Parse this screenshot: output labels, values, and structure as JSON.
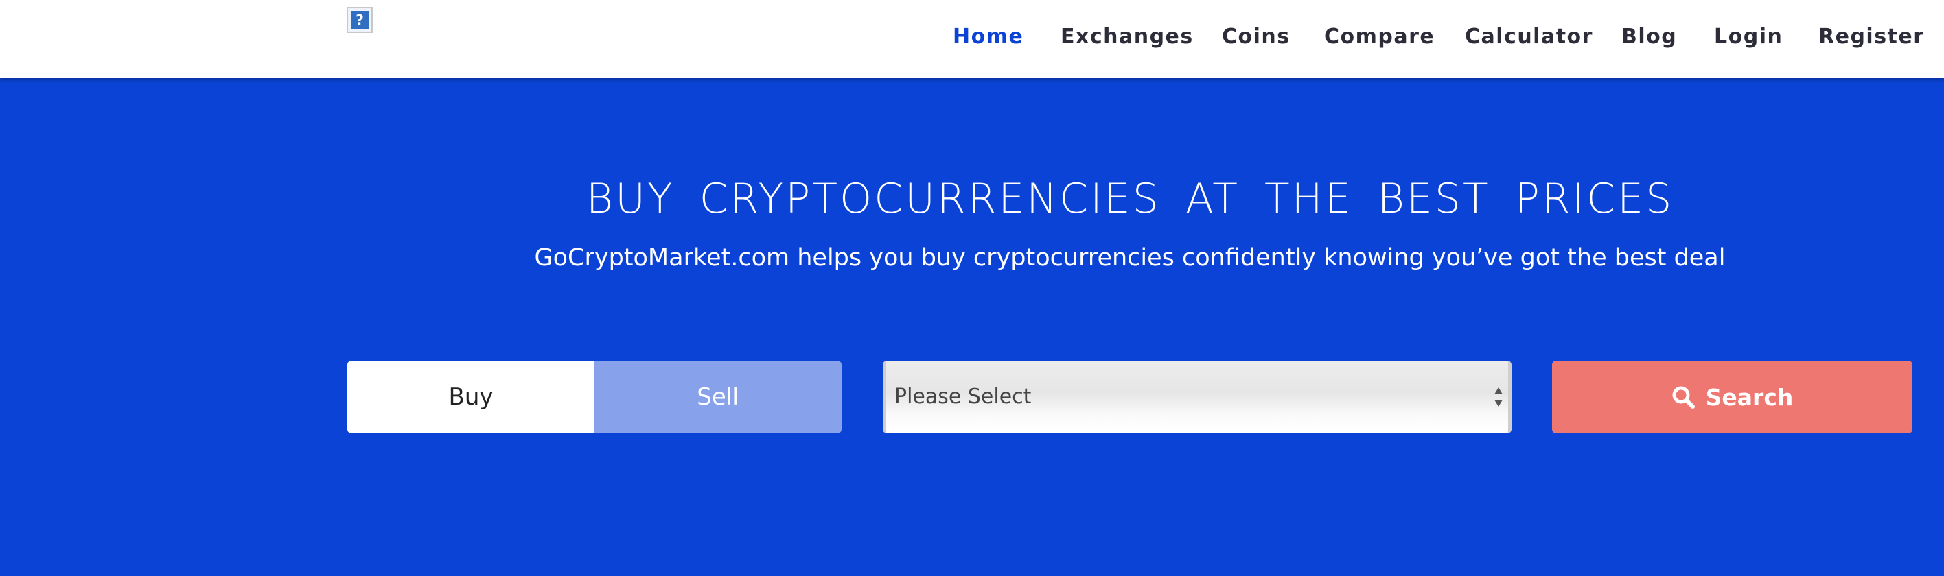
{
  "header": {
    "logo_icon": "broken-image-placeholder-icon",
    "logo_glyph": "?",
    "nav": [
      {
        "label": "Home",
        "active": true
      },
      {
        "label": "Exchanges",
        "active": false
      },
      {
        "label": "Coins",
        "active": false
      },
      {
        "label": "Compare",
        "active": false
      },
      {
        "label": "Calculator",
        "active": false
      },
      {
        "label": "Blog",
        "active": false
      },
      {
        "label": "Login",
        "active": false
      },
      {
        "label": "Register",
        "active": false
      }
    ]
  },
  "hero": {
    "title": "BUY CRYPTOCURRENCIES AT THE BEST PRICES",
    "subtitle": "GoCryptoMarket.com helps you buy cryptocurrencies confidently knowing you’ve got the best deal"
  },
  "form": {
    "buy_label": "Buy",
    "sell_label": "Sell",
    "selected_mode": "Buy",
    "select_value": "Please Select",
    "search_label": "Search",
    "search_icon": "search-icon"
  },
  "colors": {
    "brand_blue": "#0b43d6",
    "sell_inactive": "#87a2ea",
    "search_button": "#ef7772",
    "nav_text": "#2d2d3a",
    "nav_active": "#0b43d6"
  }
}
